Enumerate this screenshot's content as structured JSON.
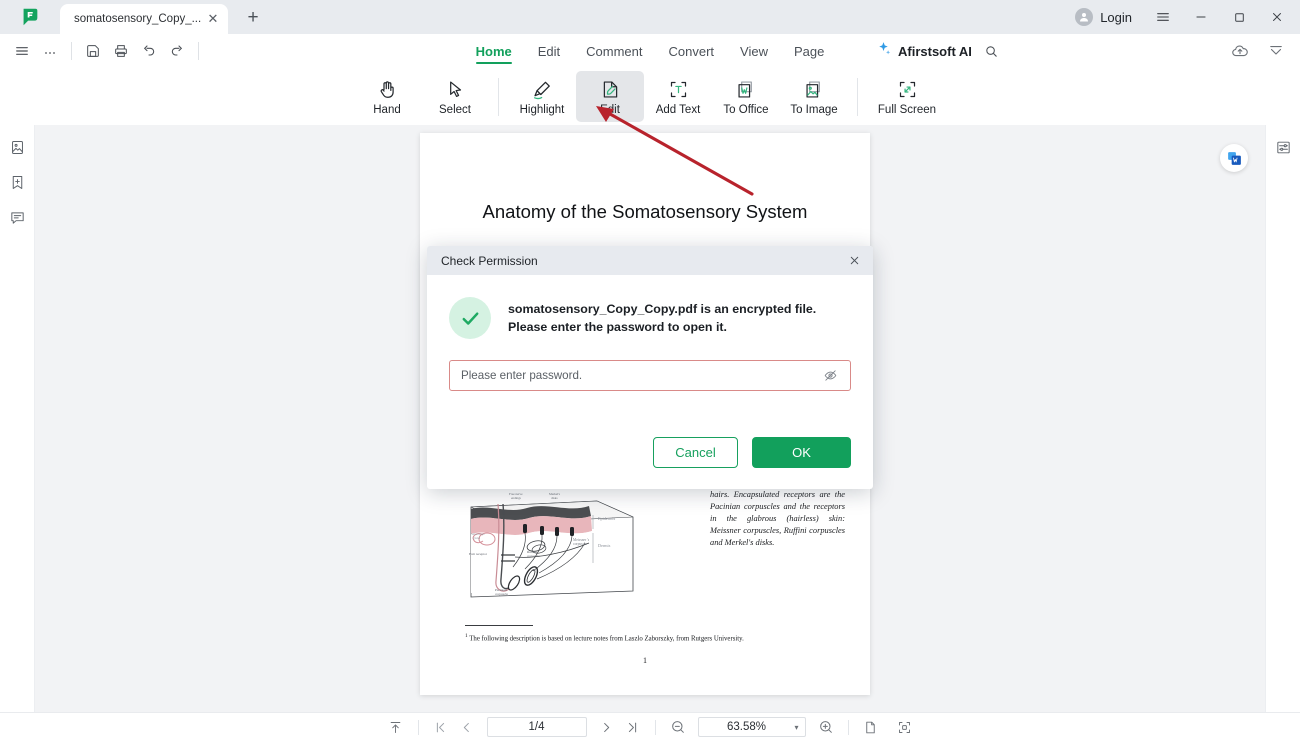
{
  "titlebar": {
    "logo": "afirstsoft-logo",
    "tab": {
      "title": "somatosensory_Copy_...",
      "close": "✕"
    },
    "new_tab": "+",
    "login_label": "Login",
    "hamburger": "☰",
    "minimize": "—",
    "maximize": "□",
    "close": "✕"
  },
  "menubar": {
    "left_tools": [
      "menu-icon",
      "more-icon",
      "save-icon",
      "print-icon",
      "undo-icon",
      "redo-icon"
    ],
    "items": [
      {
        "label": "Home",
        "active": true
      },
      {
        "label": "Edit",
        "active": false
      },
      {
        "label": "Comment",
        "active": false
      },
      {
        "label": "Convert",
        "active": false
      },
      {
        "label": "View",
        "active": false
      },
      {
        "label": "Page",
        "active": false
      }
    ],
    "ai_label": "Afirstsoft AI",
    "search_icon": "search-icon",
    "cloud_upload_icon": "cloud-upload-icon",
    "collapse_icon": "collapse-ribbon-icon"
  },
  "toolbar": {
    "groups": [
      [
        {
          "label": "Hand",
          "icon": "hand-icon",
          "selected": false
        },
        {
          "label": "Select",
          "icon": "cursor-select-icon",
          "selected": false
        }
      ],
      [
        {
          "label": "Highlight",
          "icon": "highlight-pen-icon",
          "selected": false
        },
        {
          "label": "Edit",
          "icon": "edit-document-icon",
          "selected": true
        },
        {
          "label": "Add Text",
          "icon": "add-text-icon",
          "selected": false
        },
        {
          "label": "To Office",
          "icon": "to-office-icon",
          "selected": false
        },
        {
          "label": "To Image",
          "icon": "to-image-icon",
          "selected": false
        }
      ],
      [
        {
          "label": "Full Screen",
          "icon": "full-screen-icon",
          "selected": false
        }
      ]
    ]
  },
  "left_rail": [
    {
      "name": "thumbnails-panel",
      "icon": "image-thumbnail-icon"
    },
    {
      "name": "bookmarks-panel",
      "icon": "bookmark-add-icon"
    },
    {
      "name": "comments-panel",
      "icon": "comment-icon"
    }
  ],
  "right_rail": [
    {
      "name": "properties-panel",
      "icon": "properties-sliders-icon"
    }
  ],
  "document": {
    "title": "Anatomy of the Somatosensory System",
    "paragraph": "hairs. Encapsulated receptors are the Pacinian corpuscles and the receptors in the glabrous (hairless) skin: Meissner corpuscles, Ruffini corpuscles and Merkel's disks.",
    "footnote_marker": "1",
    "footnote": "The following description is based on lecture notes from Laszlo Zaborszky, from Rutgers University.",
    "page_number": "1",
    "word_badge_icon": "word-convert-icon",
    "figure_labels": {
      "epidermis": "Epidermis",
      "dermis": "Dermis",
      "free_nerve": "Free nerve endings",
      "merkel": "Merkel's disks",
      "sebaceous": "Sebaceous gland",
      "meissner": "Meissner's corpuscle",
      "ruffini": "Ruffini corpuscle",
      "hair_receptor": "Hair receptor",
      "pacinian": "Pacinian corpuscle"
    }
  },
  "dialog": {
    "title": "Check Permission",
    "close_icon": "close-icon",
    "status_icon": "check-circle-icon",
    "message_line1": "somatosensory_Copy_Copy.pdf is an encrypted file.",
    "message_line2": "Please enter the password to open it.",
    "password_value": "",
    "password_placeholder": "Please enter password.",
    "reveal_icon": "eye-off-icon",
    "cancel_label": "Cancel",
    "ok_label": "OK",
    "accent_color": "#12a05c",
    "field_border_color": "#d98a88"
  },
  "statusbar": {
    "scroll_top_icon": "scroll-to-top-icon",
    "first_page_icon": "first-page-icon",
    "prev_page_icon": "prev-page-icon",
    "page_value": "1/4",
    "next_page_icon": "next-page-icon",
    "last_page_icon": "last-page-icon",
    "zoom_out_icon": "zoom-out-icon",
    "zoom_value": "63.58%",
    "zoom_caret": "▾",
    "zoom_in_icon": "zoom-in-icon",
    "single_page_icon": "single-page-view-icon",
    "fit_page_icon": "fit-page-icon"
  }
}
